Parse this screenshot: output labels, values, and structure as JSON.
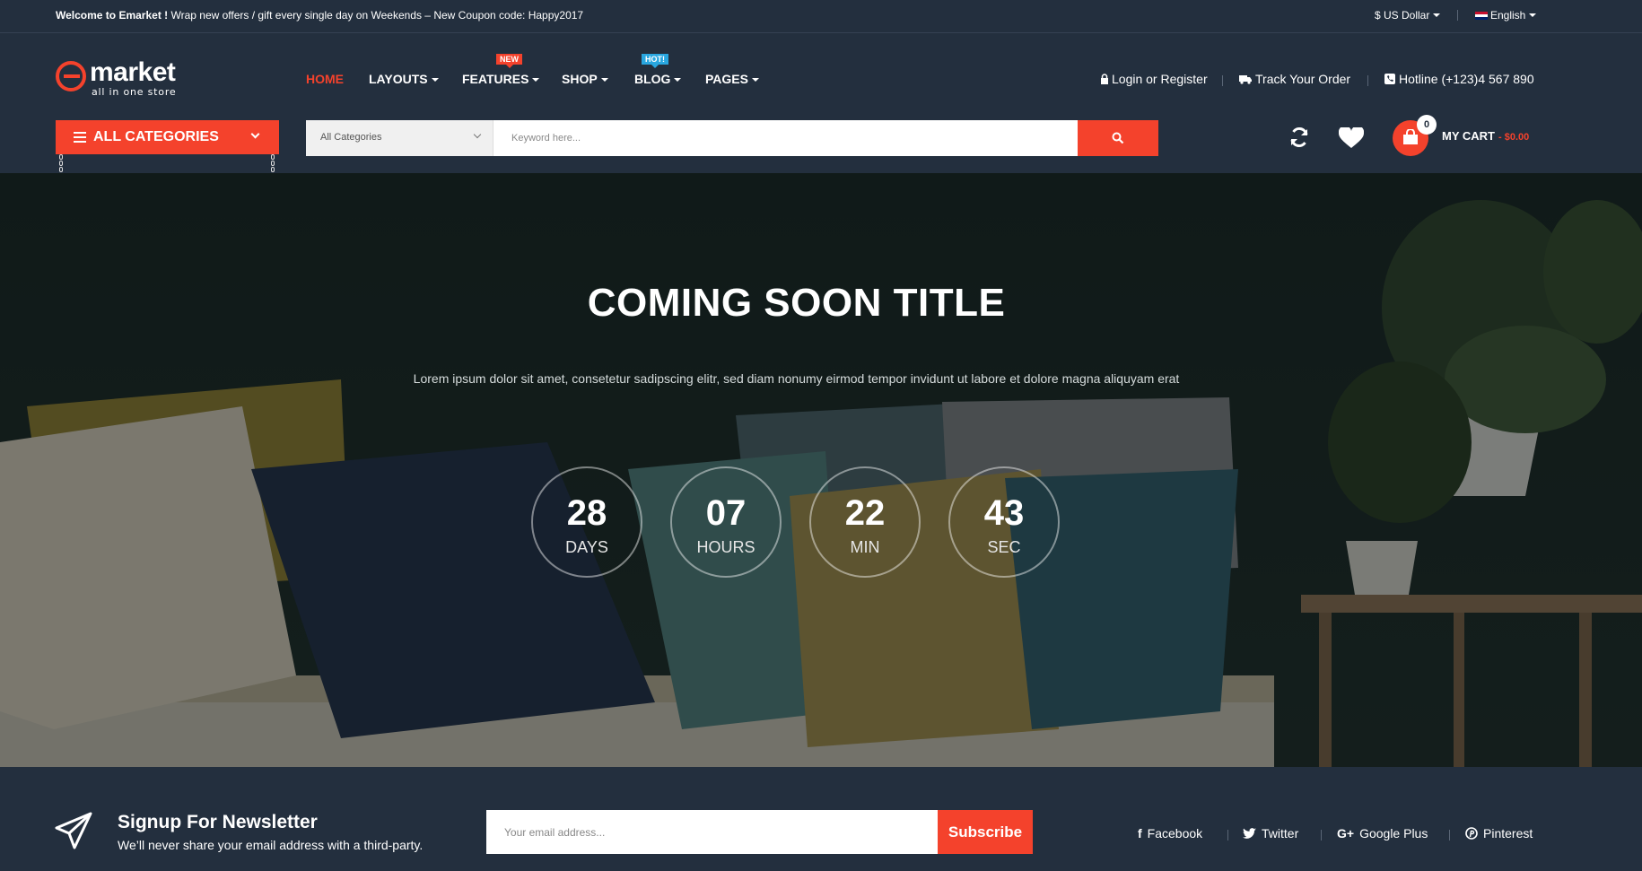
{
  "topbar": {
    "welcome_strong": "Welcome to Emarket !",
    "welcome_text": " Wrap new offers / gift every single day on Weekends – New Coupon code: Happy2017",
    "currency": "$ US Dollar",
    "language": "English"
  },
  "logo": {
    "word": "market",
    "tagline": "all in one store"
  },
  "nav": [
    {
      "label": "HOME",
      "active": true
    },
    {
      "label": "LAYOUTS"
    },
    {
      "label": "FEATURES",
      "badge": "NEW"
    },
    {
      "label": "SHOP"
    },
    {
      "label": "BLOG",
      "badge": "HOT!"
    },
    {
      "label": "PAGES"
    }
  ],
  "header_links": {
    "login": "Login or Register",
    "track": "Track Your Order",
    "hotline": "Hotline (+123)4 567 890"
  },
  "categories_button": "ALL CATEGORIES",
  "search": {
    "category": "All Categories",
    "placeholder": "Keyword here..."
  },
  "cart": {
    "count": "0",
    "label": "MY CART",
    "total": "- $0.00"
  },
  "hero": {
    "title": "COMING SOON TITLE",
    "subtitle": "Lorem ipsum dolor sit amet, consetetur sadipscing elitr, sed diam nonumy eirmod tempor invidunt ut labore et dolore magna aliquyam erat",
    "countdown": [
      {
        "value": "28",
        "unit": "DAYS"
      },
      {
        "value": "07",
        "unit": "HOURS"
      },
      {
        "value": "22",
        "unit": "MIN"
      },
      {
        "value": "43",
        "unit": "SEC"
      }
    ]
  },
  "newsletter": {
    "title": "Signup For Newsletter",
    "subtitle": "We’ll never share your email address with a third-party.",
    "placeholder": "Your email address...",
    "button": "Subscribe"
  },
  "social": [
    "Facebook",
    "Twitter",
    "Google Plus",
    "Pinterest"
  ],
  "colors": {
    "accent": "#f4422c",
    "background": "#232f3e",
    "hot_badge": "#29a7e0"
  }
}
